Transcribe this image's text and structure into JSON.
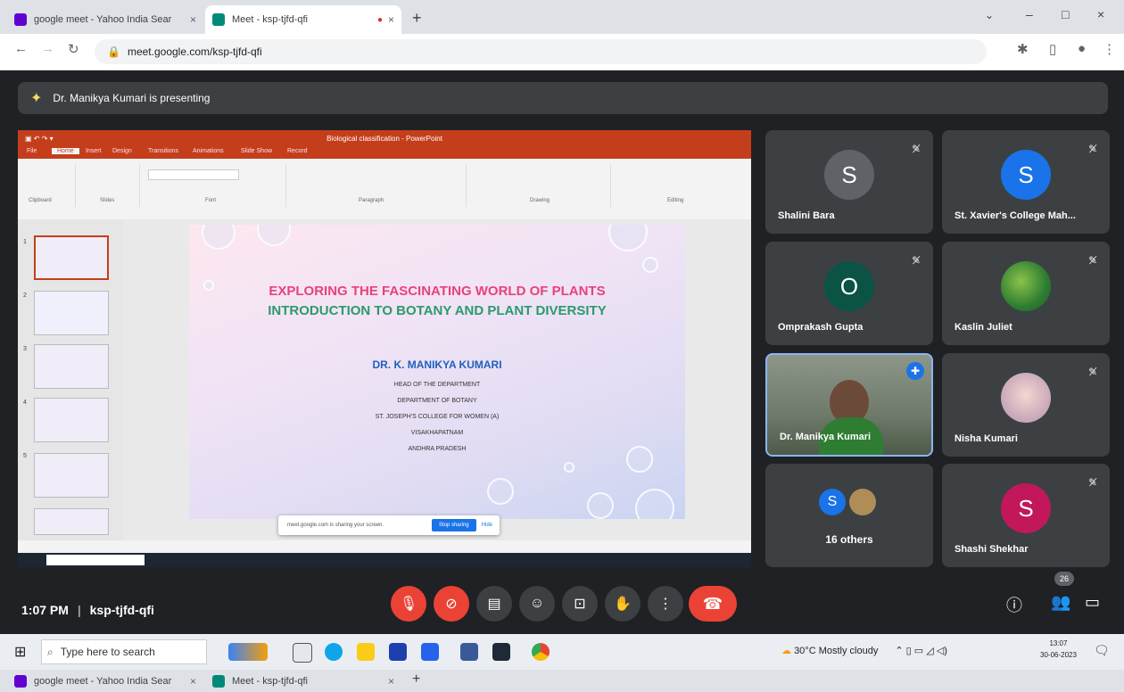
{
  "browser": {
    "tabs": [
      {
        "label": "google meet - Yahoo India Sear",
        "close": "×"
      },
      {
        "label": "Meet - ksp-tjfd-qfi",
        "close": "×"
      }
    ],
    "new_tab": "+",
    "url": "meet.google.com/ksp-tjfd-qfi",
    "window_controls": [
      "⌄",
      "–",
      "□",
      "×"
    ]
  },
  "meet": {
    "presenting_text": "Dr. Manikya Kumari is presenting",
    "time": "1:07 PM",
    "meeting_code": "ksp-tjfd-qfi",
    "participant_count": "26",
    "participants": [
      {
        "name": "Shalini Bara",
        "initial": "S",
        "color": "#5f6368"
      },
      {
        "name": "St. Xavier's College Mah...",
        "initial": "S",
        "color": "#1a73e8"
      },
      {
        "name": "Omprakash Gupta",
        "initial": "O",
        "color": "#0b5345"
      },
      {
        "name": "Kaslin Juliet",
        "initial": "",
        "color": "#3c7a3e"
      },
      {
        "name": "Dr. Manikya Kumari",
        "initial": "",
        "color": "#6f7a6b"
      },
      {
        "name": "Nisha Kumari",
        "initial": "",
        "color": "#c7a6b8"
      },
      {
        "name": "16 others",
        "initial": "S",
        "color": "#1a73e8"
      },
      {
        "name": "Shashi Shekhar",
        "initial": "S",
        "color": "#c2185b"
      }
    ],
    "controls": {
      "mic_icon": "microphone-off-icon",
      "cam_icon": "camera-off-icon",
      "cc_icon": "captions-icon",
      "emoji_icon": "emoji-icon",
      "present_icon": "present-icon",
      "hand_icon": "raise-hand-icon",
      "more_icon": "more-options-icon",
      "end_icon": "end-call-icon"
    }
  },
  "slide": {
    "title_line1": "EXPLORING THE FASCINATING WORLD OF PLANTS",
    "title_line2": "INTRODUCTION TO BOTANY AND PLANT DIVERSITY",
    "presenter": "DR. K. MANIKYA KUMARI",
    "lines": [
      "HEAD OF THE DEPARTMENT",
      "DEPARTMENT OF BOTANY",
      "ST. JOSEPH'S COLLEGE FOR WOMEN (A)",
      "VISAKHAPATNAM",
      "ANDHRA PRADESH"
    ],
    "title1_color": "#e9417c",
    "title2_color": "#2a9a6d",
    "presenter_color": "#1f5fbf",
    "share_popup": "meet.google.com is sharing your screen.",
    "stop_sharing": "Stop sharing",
    "hide": "Hide"
  },
  "taskbar": {
    "search_placeholder": "Type here to search",
    "weather": "30°C  Mostly cloudy",
    "time": "13:07",
    "date": "30-06-2023"
  }
}
